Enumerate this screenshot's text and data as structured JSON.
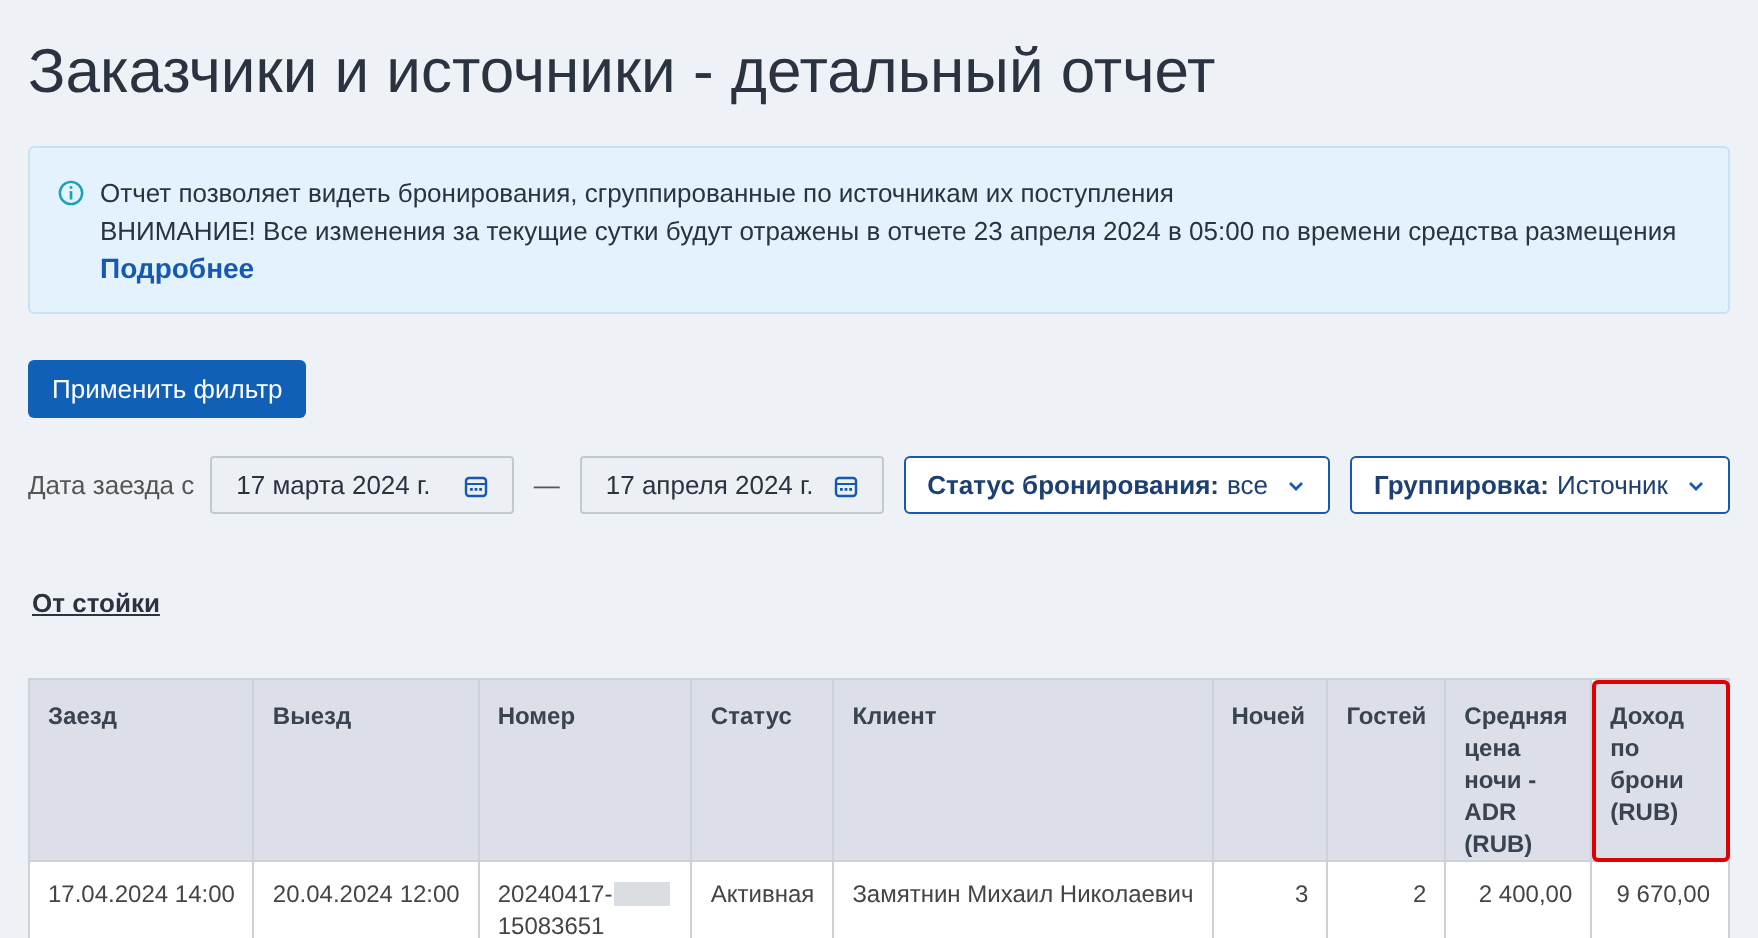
{
  "title": "Заказчики и источники - детальный отчет",
  "info": {
    "lines": [
      "Отчет позволяет видеть бронирования, сгруппированные по источникам их поступления",
      "ВНИМАНИЕ! Все изменения за текущие сутки будут отражены в отчете 23 апреля 2024 в 05:00 по времени средства размещения"
    ],
    "link": "Подробнее"
  },
  "apply_button": "Применить фильтр",
  "filters": {
    "date_label": "Дата заезда с",
    "date_from": "17 марта 2024 г.",
    "separator": "—",
    "date_to": "17 апреля 2024 г.",
    "dropdowns": [
      {
        "label": "Статус бронирования:",
        "value": "все"
      },
      {
        "label": "Группировка:",
        "value": "Источник"
      }
    ]
  },
  "section": "От стойки",
  "table": {
    "columns": [
      {
        "label": "Заезд",
        "highlighted": false
      },
      {
        "label": "Выезд",
        "highlighted": false
      },
      {
        "label": "Номер",
        "highlighted": false
      },
      {
        "label": "Статус",
        "highlighted": false
      },
      {
        "label": "Клиент",
        "highlighted": false
      },
      {
        "label": "Ночей",
        "highlighted": false
      },
      {
        "label": "Гостей",
        "highlighted": false
      },
      {
        "label": "Средняя цена ночи - ADR (RUB)",
        "highlighted": false
      },
      {
        "label": "Доход по брони (RUB)",
        "highlighted": true
      }
    ],
    "rows": [
      {
        "cells": [
          "17.04.2024 14:00",
          "20.04.2024 12:00",
          "20240417-",
          "Активная",
          "Замятнин Михаил Николаевич",
          "3",
          "2",
          "2 400,00",
          "9 670,00"
        ],
        "number_suffix": "15083651",
        "number_redacted": true
      }
    ]
  }
}
